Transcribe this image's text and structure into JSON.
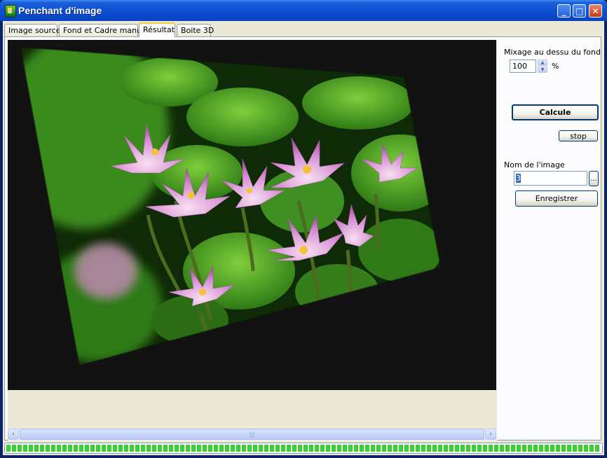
{
  "window": {
    "title": "Penchant d'image"
  },
  "title_buttons": {
    "minimize": "_",
    "maximize": "□",
    "close": "✕"
  },
  "tabs": [
    {
      "label": "Image source"
    },
    {
      "label": "Fond et Cadre manuel"
    },
    {
      "label": "Résultat"
    },
    {
      "label": "Boite 3D"
    }
  ],
  "active_tab": "Résultat",
  "preview": {
    "content": "photo of pink water lilies on green lily pads, tilted in perspective on a dark background"
  },
  "scrollbar": {
    "left_arrow": "‹",
    "right_arrow": "›",
    "grip": "|||"
  },
  "side": {
    "mix_label": "Mixage au dessu du fond",
    "mix_value": "100",
    "mix_unit": "%",
    "calc_button": "Calcule",
    "stop_button": "stop",
    "name_label": "Nom de l'image",
    "name_value": "3",
    "browse_button": "...",
    "save_button": "Enregistrer"
  },
  "progress": {
    "value": 1.0
  },
  "colors": {
    "titlebar": "#0a4fd0",
    "progress": "#37d12d",
    "tab_highlight": "#ffc83c"
  },
  "icons": [
    "app-icon",
    "minimize-icon",
    "maximize-icon",
    "close-icon",
    "spin-up-icon",
    "spin-down-icon",
    "scroll-left-icon",
    "scroll-right-icon"
  ]
}
